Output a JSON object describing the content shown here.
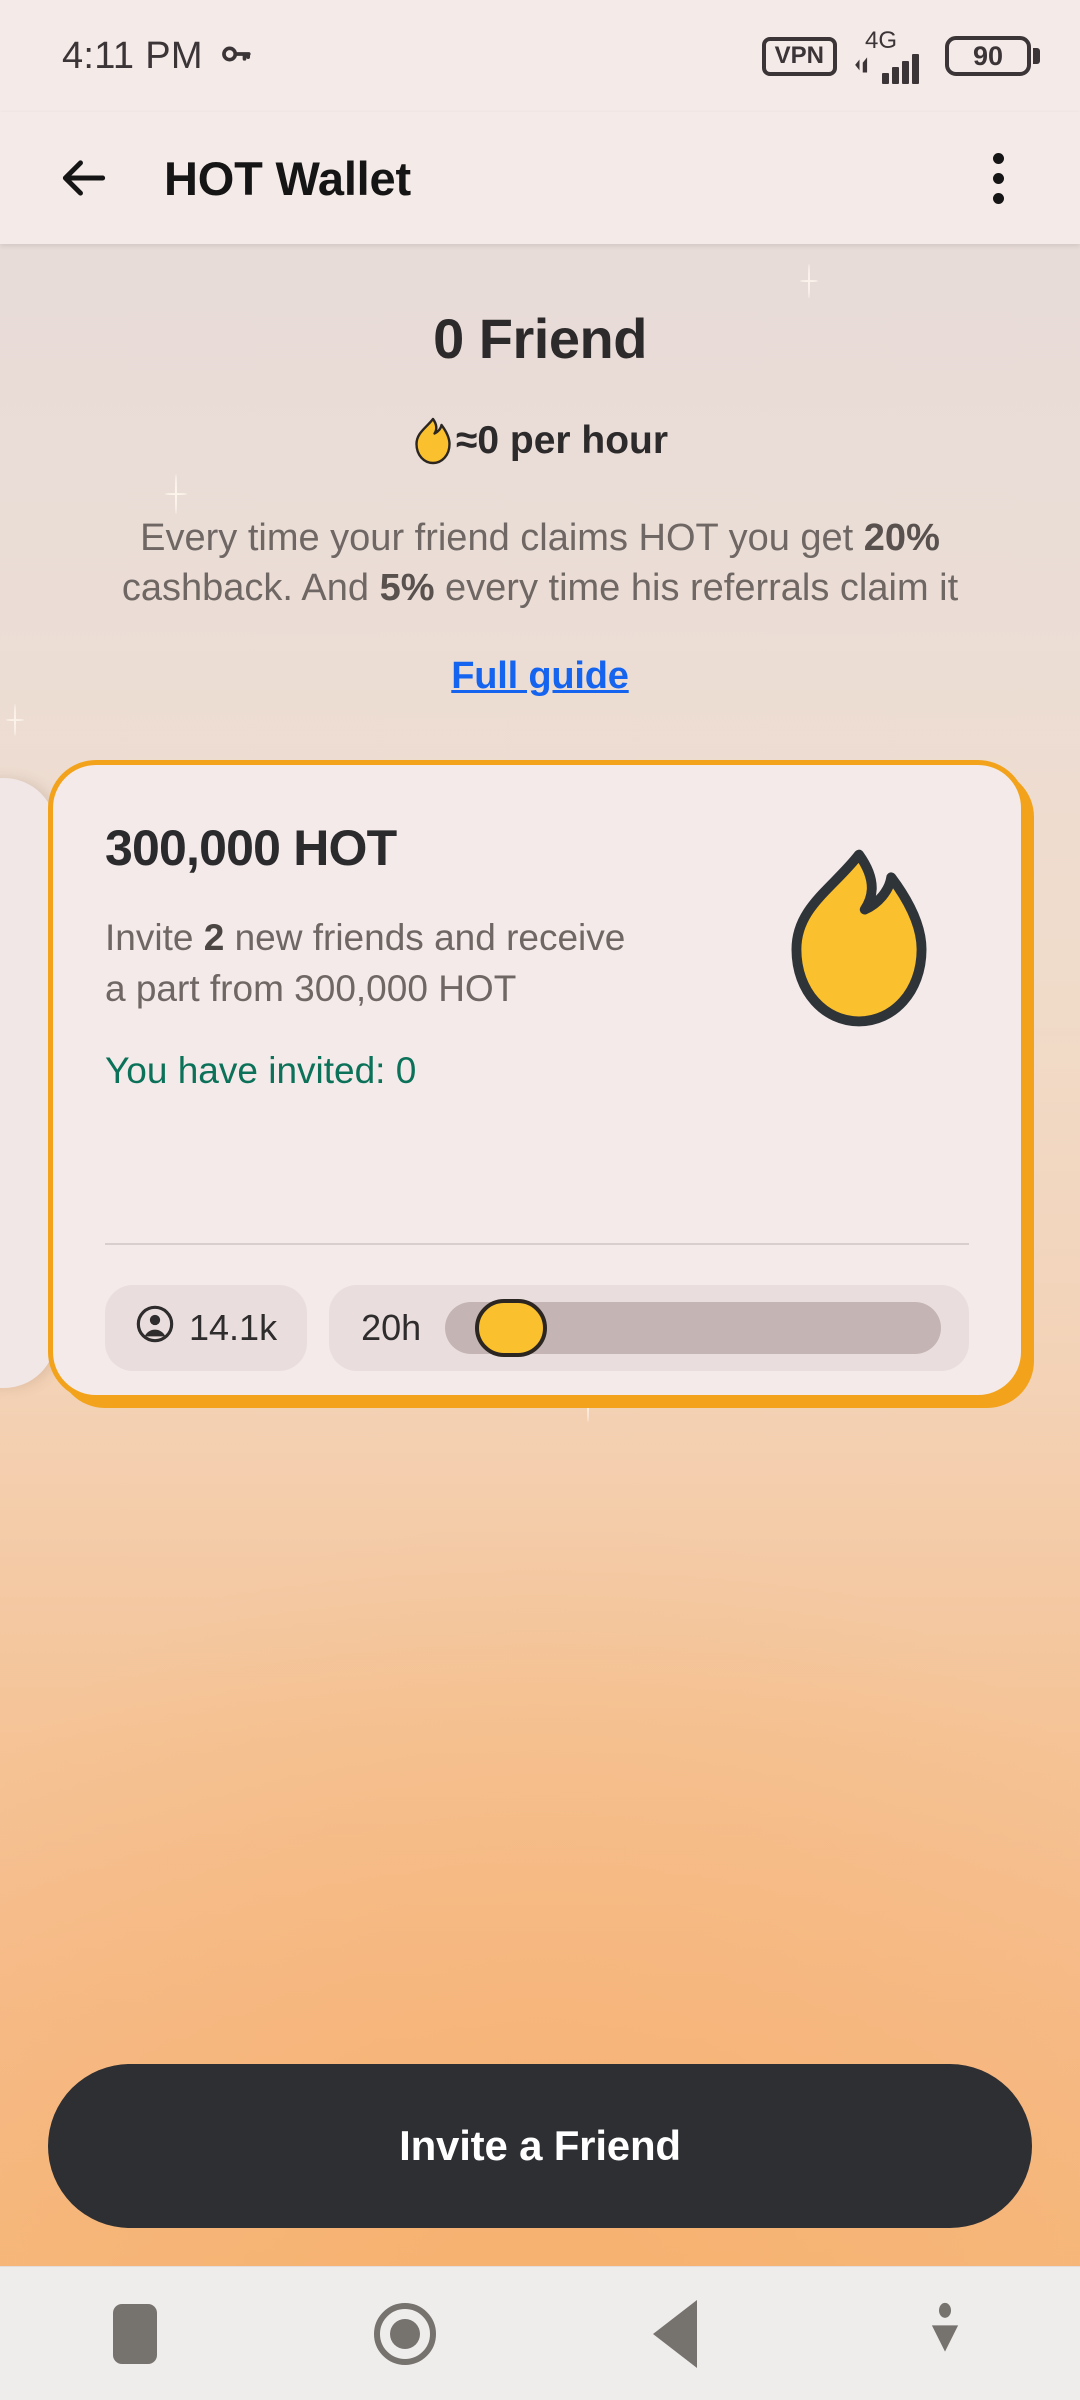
{
  "status_bar": {
    "time": "4:11 PM",
    "key_icon": "key-icon",
    "vpn_label": "VPN",
    "network_label": "4G",
    "battery_level": "90"
  },
  "app_bar": {
    "back_icon": "back-arrow-icon",
    "title": "HOT Wallet",
    "overflow_icon": "kebab-menu-icon"
  },
  "hero": {
    "title": "0 Friend",
    "rate_icon": "flame-icon",
    "rate": "≈0 per hour",
    "description_part1": "Every time your friend claims HOT you get ",
    "description_bold1": "20%",
    "description_part2": " cashback. And ",
    "description_bold2": "5%",
    "description_part3": " every time his referrals claim it",
    "full_guide_label": "Full guide",
    "link_color": "#1464F0"
  },
  "reward_card": {
    "amount": "300,000 HOT",
    "desc_part1": "Invite ",
    "desc_bold": "2",
    "desc_part2": " new friends and receive",
    "desc_line2": "a part from 300,000 HOT",
    "invited_label": "You have invited: 0",
    "invited_color": "#0C7159",
    "border_color": "#F2A31B",
    "flame_icon": "flame-icon",
    "participants_icon": "account-circle-icon",
    "participants": "14.1k",
    "time_left": "20h",
    "progress_percent": 6
  },
  "cta": {
    "label": "Invite a Friend"
  },
  "nav_bar": {
    "recents_icon": "recents-square-icon",
    "home_icon": "home-circle-icon",
    "back_icon": "back-triangle-icon",
    "hide_keyboard_icon": "hide-keyboard-icon"
  }
}
